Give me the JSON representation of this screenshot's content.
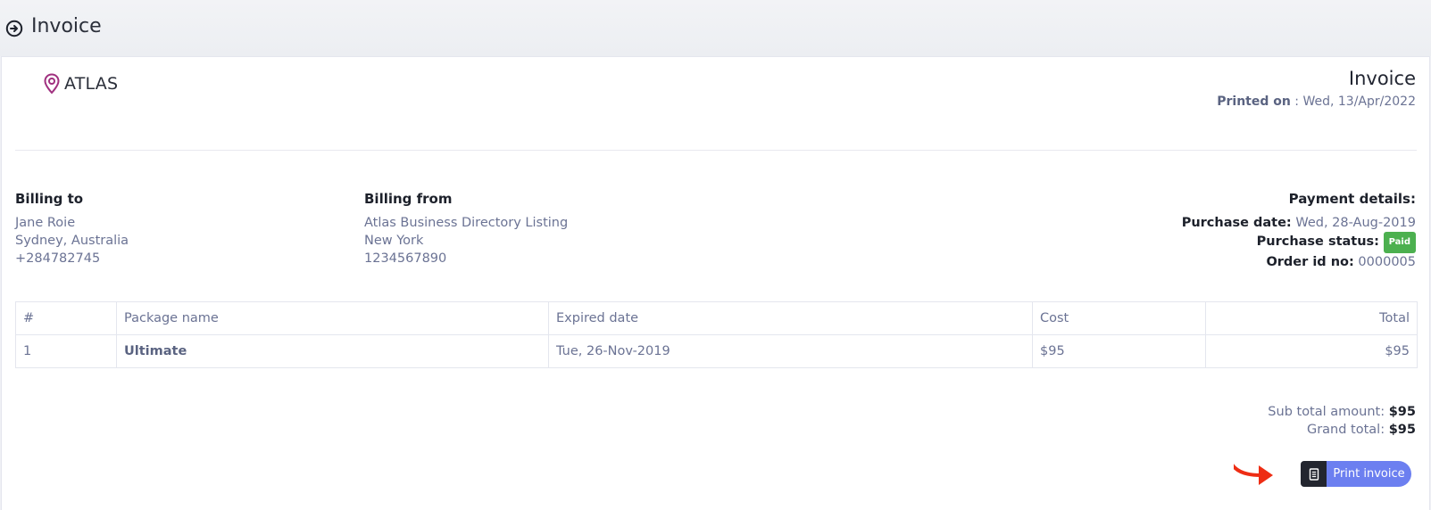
{
  "header": {
    "title": "Invoice",
    "back_icon": "circle-arrow-right-icon"
  },
  "brand": {
    "name": "ATLAS",
    "icon": "map-pin-icon",
    "accent_color": "#a0307f"
  },
  "invoice_head": {
    "title": "Invoice",
    "printed_on_label": "Printed on",
    "printed_on_sep": " : ",
    "printed_on_value": "Wed, 13/Apr/2022"
  },
  "billing_to": {
    "heading": "Billing to",
    "lines": [
      "Jane Roie",
      "Sydney, Australia",
      "+284782745"
    ]
  },
  "billing_from": {
    "heading": "Billing from",
    "lines": [
      "Atlas Business Directory Listing",
      "New York",
      "1234567890"
    ]
  },
  "payment": {
    "heading": "Payment details:",
    "purchase_date_label": "Purchase date:",
    "purchase_date_value": "Wed, 28-Aug-2019",
    "purchase_status_label": "Purchase status:",
    "purchase_status_value": "Paid",
    "purchase_status_color": "#4cb04f",
    "order_id_label": "Order id no:",
    "order_id_value": "0000005"
  },
  "table": {
    "headers": [
      "#",
      "Package name",
      "Expired date",
      "Cost",
      "Total"
    ],
    "rows": [
      [
        "1",
        "Ultimate",
        "Tue, 26-Nov-2019",
        "$95",
        "$95"
      ]
    ]
  },
  "totals": {
    "subtotal_label": "Sub total amount:",
    "subtotal_value": "$95",
    "grand_label": "Grand total:",
    "grand_value": "$95"
  },
  "print_button": {
    "label": "Print invoice",
    "icon": "document-icon",
    "color": "#6c7ff0"
  },
  "annotation": {
    "icon": "red-curved-arrow-icon",
    "color": "#ee2d14"
  }
}
